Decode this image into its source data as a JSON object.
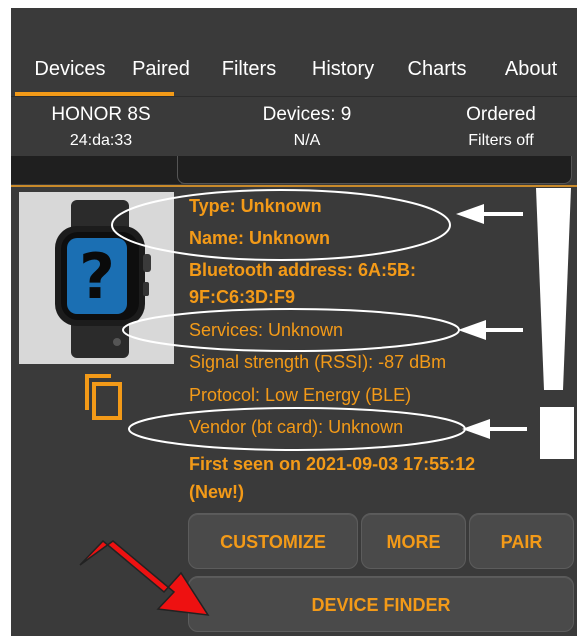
{
  "tabs": [
    "Devices",
    "Paired",
    "Filters",
    "History",
    "Charts",
    "About"
  ],
  "status": {
    "phone_name": "HONOR 8S",
    "phone_mac": "24:da:33",
    "devices_count": "Devices: 9",
    "devices_sub": "N/A",
    "order": "Ordered",
    "filters": "Filters off"
  },
  "device": {
    "image_icon": "smartwatch-question-icon",
    "type": "Type: Unknown",
    "name": "Name: Unknown",
    "address_line1": "Bluetooth address: 6A:5B:",
    "address_line2": "9F:C6:3D:F9",
    "services": "Services: Unknown",
    "rssi": "Signal strength (RSSI): -87 dBm",
    "protocol": "Protocol: Low Energy (BLE)",
    "vendor": "Vendor (bt card): Unknown",
    "first_seen_line1": "First seen on 2021-09-03 17:55:12",
    "first_seen_line2": "(New!)"
  },
  "buttons": {
    "customize": "CUSTOMIZE",
    "more": "MORE",
    "pair": "PAIR",
    "device_finder": "DEVICE FINDER"
  },
  "colors": {
    "accent": "#f39a18",
    "background": "#3a3a3a",
    "annotation_arrow": "#ee1111"
  }
}
